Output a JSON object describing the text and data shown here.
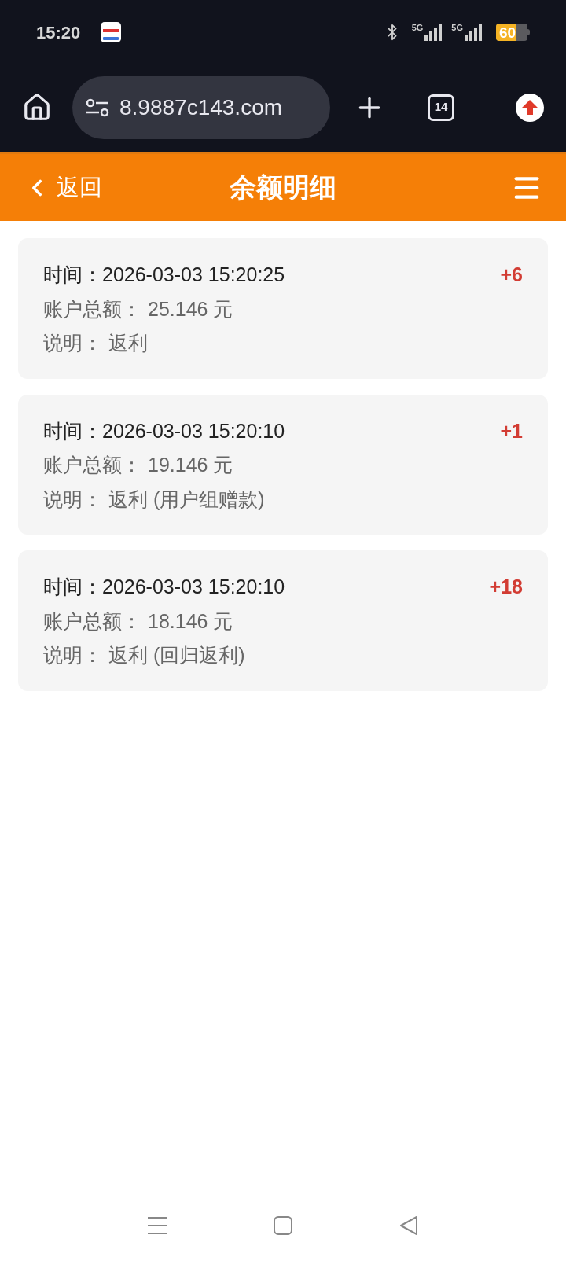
{
  "status_bar": {
    "time": "15:20",
    "networks": [
      "5G",
      "5G"
    ],
    "battery": "60"
  },
  "browser": {
    "url": "8.9887c143.com",
    "tab_count": "14"
  },
  "header": {
    "back": "返回",
    "title": "余额明细"
  },
  "records": [
    {
      "time_label": "时间：",
      "time": "2026-03-03 15:20:25",
      "amount": "+6",
      "balance_label": "账户总额：",
      "balance": "25.146 元",
      "note_label": "说明：",
      "note": "返利"
    },
    {
      "time_label": "时间：",
      "time": "2026-03-03 15:20:10",
      "amount": "+1",
      "balance_label": "账户总额：",
      "balance": "19.146 元",
      "note_label": "说明：",
      "note": "返利 (用户组赠款)"
    },
    {
      "time_label": "时间：",
      "time": "2026-03-03 15:20:10",
      "amount": "+18",
      "balance_label": "账户总额：",
      "balance": "18.146 元",
      "note_label": "说明：",
      "note": "返利 (回归返利)"
    }
  ]
}
